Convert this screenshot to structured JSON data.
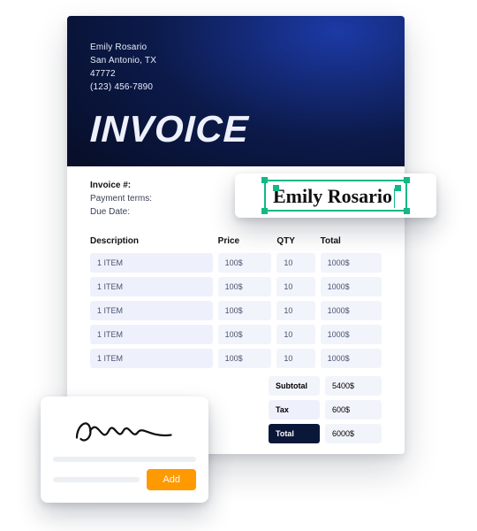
{
  "header": {
    "name": "Emily Rosario",
    "city": "San Antonio, TX",
    "zip": "47772",
    "phone": "(123) 456-7890",
    "title": "INVOICE"
  },
  "meta": {
    "invoiceNumLabel": "Invoice #:",
    "paymentTermsLabel": "Payment terms:",
    "dueDateLabel": "Due Date:"
  },
  "columns": {
    "description": "Description",
    "price": "Price",
    "qty": "QTY",
    "total": "Total"
  },
  "rows": [
    {
      "desc": "1 ITEM",
      "price": "100$",
      "qty": "10",
      "total": "1000$"
    },
    {
      "desc": "1 ITEM",
      "price": "100$",
      "qty": "10",
      "total": "1000$"
    },
    {
      "desc": "1 ITEM",
      "price": "100$",
      "qty": "10",
      "total": "1000$"
    },
    {
      "desc": "1 ITEM",
      "price": "100$",
      "qty": "10",
      "total": "1000$"
    },
    {
      "desc": "1 ITEM",
      "price": "100$",
      "qty": "10",
      "total": "1000$"
    }
  ],
  "summary": {
    "subtotalLabel": "Subtotal",
    "subtotal": "5400$",
    "taxLabel": "Tax",
    "tax": "600$",
    "totalLabel": "Total",
    "total": "6000$"
  },
  "editOverlay": {
    "text": "Emily Rosario"
  },
  "signature": {
    "addLabel": "Add"
  },
  "colors": {
    "accent": "#12b886",
    "action": "#ff9900",
    "navy": "#0b1738"
  }
}
